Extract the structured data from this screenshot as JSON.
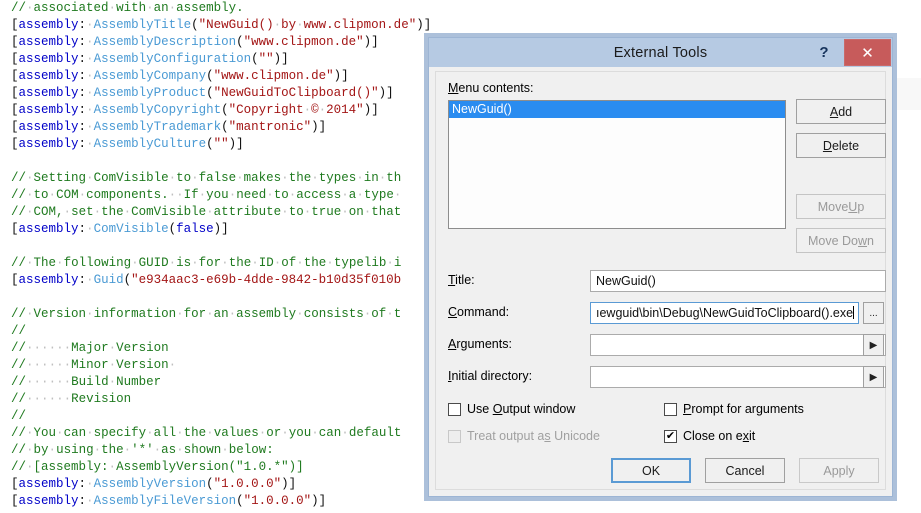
{
  "editor": {
    "lines": [
      [
        {
          "t": "// associated with an assembly.",
          "c": "com"
        }
      ],
      [
        {
          "t": "[",
          "c": "pl"
        },
        {
          "t": "assembly",
          "c": "kw"
        },
        {
          "t": ": ",
          "c": "pl"
        },
        {
          "t": "AssemblyTitle",
          "c": "type"
        },
        {
          "t": "(",
          "c": "pl"
        },
        {
          "t": "\"NewGuid() by www.clipmon.de\"",
          "c": "str"
        },
        {
          "t": ")]",
          "c": "pl"
        }
      ],
      [
        {
          "t": "[",
          "c": "pl"
        },
        {
          "t": "assembly",
          "c": "kw"
        },
        {
          "t": ": ",
          "c": "pl"
        },
        {
          "t": "AssemblyDescription",
          "c": "type"
        },
        {
          "t": "(",
          "c": "pl"
        },
        {
          "t": "\"www.clipmon.de\"",
          "c": "str"
        },
        {
          "t": ")]",
          "c": "pl"
        }
      ],
      [
        {
          "t": "[",
          "c": "pl"
        },
        {
          "t": "assembly",
          "c": "kw"
        },
        {
          "t": ": ",
          "c": "pl"
        },
        {
          "t": "AssemblyConfiguration",
          "c": "type"
        },
        {
          "t": "(",
          "c": "pl"
        },
        {
          "t": "\"\"",
          "c": "str"
        },
        {
          "t": ")]",
          "c": "pl"
        }
      ],
      [
        {
          "t": "[",
          "c": "pl"
        },
        {
          "t": "assembly",
          "c": "kw"
        },
        {
          "t": ": ",
          "c": "pl"
        },
        {
          "t": "AssemblyCompany",
          "c": "type"
        },
        {
          "t": "(",
          "c": "pl"
        },
        {
          "t": "\"www.clipmon.de\"",
          "c": "str"
        },
        {
          "t": ")]",
          "c": "pl"
        }
      ],
      [
        {
          "t": "[",
          "c": "pl"
        },
        {
          "t": "assembly",
          "c": "kw"
        },
        {
          "t": ": ",
          "c": "pl"
        },
        {
          "t": "AssemblyProduct",
          "c": "type"
        },
        {
          "t": "(",
          "c": "pl"
        },
        {
          "t": "\"NewGuidToClipboard()\"",
          "c": "str"
        },
        {
          "t": ")]",
          "c": "pl"
        }
      ],
      [
        {
          "t": "[",
          "c": "pl"
        },
        {
          "t": "assembly",
          "c": "kw"
        },
        {
          "t": ": ",
          "c": "pl"
        },
        {
          "t": "AssemblyCopyright",
          "c": "type"
        },
        {
          "t": "(",
          "c": "pl"
        },
        {
          "t": "\"Copyright © 2014\"",
          "c": "str"
        },
        {
          "t": ")]",
          "c": "pl"
        }
      ],
      [
        {
          "t": "[",
          "c": "pl"
        },
        {
          "t": "assembly",
          "c": "kw"
        },
        {
          "t": ": ",
          "c": "pl"
        },
        {
          "t": "AssemblyTrademark",
          "c": "type"
        },
        {
          "t": "(",
          "c": "pl"
        },
        {
          "t": "\"mantronic\"",
          "c": "str"
        },
        {
          "t": ")]",
          "c": "pl"
        }
      ],
      [
        {
          "t": "[",
          "c": "pl"
        },
        {
          "t": "assembly",
          "c": "kw"
        },
        {
          "t": ": ",
          "c": "pl"
        },
        {
          "t": "AssemblyCulture",
          "c": "type"
        },
        {
          "t": "(",
          "c": "pl"
        },
        {
          "t": "\"\"",
          "c": "str"
        },
        {
          "t": ")]",
          "c": "pl"
        }
      ],
      [],
      [
        {
          "t": "// Setting ComVisible to false makes the types in th",
          "c": "com"
        }
      ],
      [
        {
          "t": "// to COM components.  If you need to access a type ",
          "c": "com"
        }
      ],
      [
        {
          "t": "// COM, set the ComVisible attribute to true on that",
          "c": "com"
        }
      ],
      [
        {
          "t": "[",
          "c": "pl"
        },
        {
          "t": "assembly",
          "c": "kw"
        },
        {
          "t": ": ",
          "c": "pl"
        },
        {
          "t": "ComVisible",
          "c": "type"
        },
        {
          "t": "(",
          "c": "pl"
        },
        {
          "t": "false",
          "c": "kw"
        },
        {
          "t": ")]",
          "c": "pl"
        }
      ],
      [],
      [
        {
          "t": "// The following GUID is for the ID of the typelib i",
          "c": "com"
        }
      ],
      [
        {
          "t": "[",
          "c": "pl"
        },
        {
          "t": "assembly",
          "c": "kw"
        },
        {
          "t": ": ",
          "c": "pl"
        },
        {
          "t": "Guid",
          "c": "type"
        },
        {
          "t": "(",
          "c": "pl"
        },
        {
          "t": "\"e934aac3-e69b-4dde-9842-b10d35f010b",
          "c": "str"
        }
      ],
      [],
      [
        {
          "t": "// Version information for an assembly consists of t",
          "c": "com"
        }
      ],
      [
        {
          "t": "//",
          "c": "com"
        }
      ],
      [
        {
          "t": "//      Major Version",
          "c": "com"
        }
      ],
      [
        {
          "t": "//      Minor Version ",
          "c": "com"
        }
      ],
      [
        {
          "t": "//      Build Number",
          "c": "com"
        }
      ],
      [
        {
          "t": "//      Revision",
          "c": "com"
        }
      ],
      [
        {
          "t": "//",
          "c": "com"
        }
      ],
      [
        {
          "t": "// You can specify all the values or you can default",
          "c": "com"
        }
      ],
      [
        {
          "t": "// by using the '*' as shown below:",
          "c": "com"
        }
      ],
      [
        {
          "t": "// [assembly: AssemblyVersion(\"1.0.*\")]",
          "c": "com"
        }
      ],
      [
        {
          "t": "[",
          "c": "pl"
        },
        {
          "t": "assembly",
          "c": "kw"
        },
        {
          "t": ": ",
          "c": "pl"
        },
        {
          "t": "AssemblyVersion",
          "c": "type"
        },
        {
          "t": "(",
          "c": "pl"
        },
        {
          "t": "\"1.0.0.0\"",
          "c": "str"
        },
        {
          "t": ")]",
          "c": "pl"
        }
      ],
      [
        {
          "t": "[",
          "c": "pl"
        },
        {
          "t": "assembly",
          "c": "kw"
        },
        {
          "t": ": ",
          "c": "pl"
        },
        {
          "t": "AssemblyFileVersion",
          "c": "type"
        },
        {
          "t": "(",
          "c": "pl"
        },
        {
          "t": "\"1.0.0.0\"",
          "c": "str"
        },
        {
          "t": ")]",
          "c": "pl"
        }
      ]
    ]
  },
  "dialog": {
    "title": "External Tools",
    "help_glyph": "?",
    "close_glyph": "✕",
    "menu_contents_label": "Menu contents:",
    "list_items": [
      {
        "label": "NewGuid()",
        "selected": true
      }
    ],
    "side_buttons": [
      {
        "label": "Add",
        "enabled": true
      },
      {
        "label": "Delete",
        "enabled": true
      },
      {
        "label": "Move Up",
        "enabled": false
      },
      {
        "label": "Move Down",
        "enabled": false
      }
    ],
    "fields": {
      "title": {
        "label": "Title:",
        "value": "NewGuid()",
        "placeholder": ""
      },
      "command": {
        "label": "Command:",
        "value": "ıewguid\\bin\\Debug\\NewGuidToClipboard().exe",
        "placeholder": "",
        "browse_label": "..."
      },
      "arguments": {
        "label": "Arguments:",
        "value": "",
        "placeholder": "",
        "dropdown_glyph": "▶"
      },
      "initial_dir": {
        "label": "Initial directory:",
        "value": "",
        "placeholder": "",
        "dropdown_glyph": "▶"
      }
    },
    "checkboxes": [
      {
        "label": "Use Output window",
        "checked": false,
        "enabled": true
      },
      {
        "label": "Treat output as Unicode",
        "checked": false,
        "enabled": false
      },
      {
        "label": "Prompt for arguments",
        "checked": false,
        "enabled": true
      },
      {
        "label": "Close on exit",
        "checked": true,
        "enabled": true
      }
    ],
    "check_glyph": "✔",
    "footer_buttons": [
      {
        "label": "OK",
        "enabled": true,
        "default": true
      },
      {
        "label": "Cancel",
        "enabled": true,
        "default": false
      },
      {
        "label": "Apply",
        "enabled": false,
        "default": false
      }
    ]
  },
  "colors": {
    "titlebar": "#b6cae3",
    "close_button": "#c75b5b",
    "selection": "#2a8cf0",
    "dialog_bg": "#f0f0f0",
    "comment_green": "#1f7a1f",
    "string_red": "#a31515",
    "keyword_blue": "#0000c8",
    "type_teal": "#4a9ad4"
  }
}
